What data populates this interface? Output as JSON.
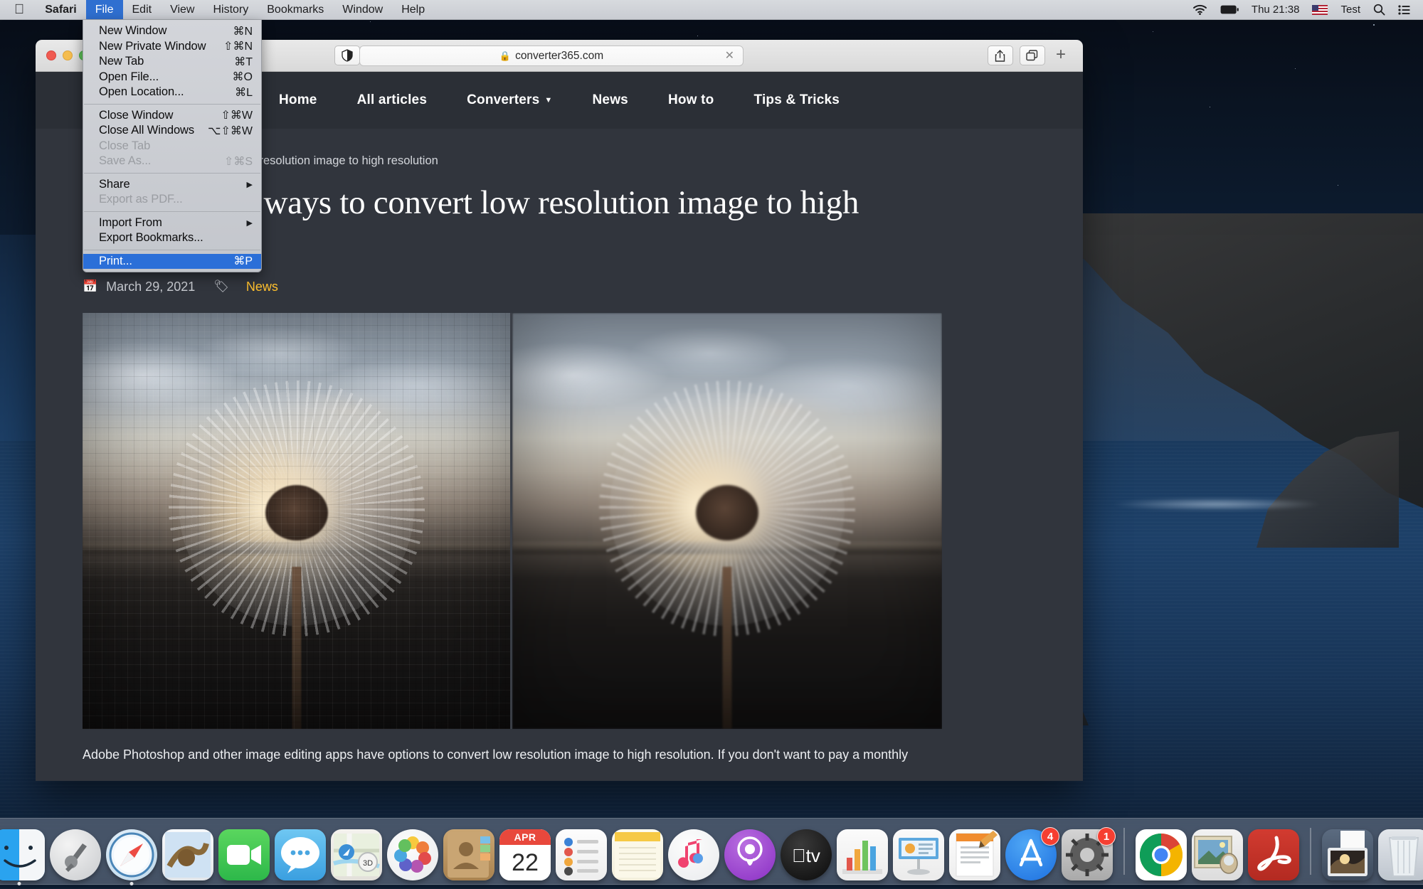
{
  "menubar": {
    "apple_logo": "apple-logo",
    "items": [
      {
        "label": "Safari",
        "active": false,
        "bold": true
      },
      {
        "label": "File",
        "active": true,
        "bold": false
      },
      {
        "label": "Edit",
        "active": false,
        "bold": false
      },
      {
        "label": "View",
        "active": false,
        "bold": false
      },
      {
        "label": "History",
        "active": false,
        "bold": false
      },
      {
        "label": "Bookmarks",
        "active": false,
        "bold": false
      },
      {
        "label": "Window",
        "active": false,
        "bold": false
      },
      {
        "label": "Help",
        "active": false,
        "bold": false
      }
    ],
    "status": {
      "wifi_icon": "wifi-icon",
      "battery_icon": "battery-icon",
      "clock": "Thu 21:38",
      "flag_icon": "us-flag-icon",
      "user": "Test",
      "search_icon": "spotlight-search-icon",
      "control_center_icon": "control-center-icon"
    }
  },
  "file_menu": {
    "groups": [
      [
        {
          "label": "New Window",
          "shortcut": "⌘N",
          "disabled": false,
          "submenu": false
        },
        {
          "label": "New Private Window",
          "shortcut": "⇧⌘N",
          "disabled": false,
          "submenu": false
        },
        {
          "label": "New Tab",
          "shortcut": "⌘T",
          "disabled": false,
          "submenu": false
        },
        {
          "label": "Open File...",
          "shortcut": "⌘O",
          "disabled": false,
          "submenu": false
        },
        {
          "label": "Open Location...",
          "shortcut": "⌘L",
          "disabled": false,
          "submenu": false
        }
      ],
      [
        {
          "label": "Close Window",
          "shortcut": "⇧⌘W",
          "disabled": false,
          "submenu": false
        },
        {
          "label": "Close All Windows",
          "shortcut": "⌥⇧⌘W",
          "disabled": false,
          "submenu": false
        },
        {
          "label": "Close Tab",
          "shortcut": "",
          "disabled": true,
          "submenu": false
        },
        {
          "label": "Save As...",
          "shortcut": "⇧⌘S",
          "disabled": true,
          "submenu": false
        }
      ],
      [
        {
          "label": "Share",
          "shortcut": "",
          "disabled": false,
          "submenu": true
        },
        {
          "label": "Export as PDF...",
          "shortcut": "",
          "disabled": true,
          "submenu": false
        }
      ],
      [
        {
          "label": "Import From",
          "shortcut": "",
          "disabled": false,
          "submenu": true
        },
        {
          "label": "Export Bookmarks...",
          "shortcut": "",
          "disabled": false,
          "submenu": false
        }
      ],
      [
        {
          "label": "Print...",
          "shortcut": "⌘P",
          "disabled": false,
          "submenu": false,
          "selected": true
        }
      ]
    ],
    "highlight_color": "#2b6fd8"
  },
  "browser": {
    "traffic_lights": [
      "close",
      "minimize",
      "zoom"
    ],
    "privacy_icon": "shield-privacy-icon",
    "reader_icon": "reader-view-icon",
    "url": "converter365.com",
    "lock_icon": "lock-icon",
    "stop_icon": "stop-reload-icon",
    "share_icon": "share-icon",
    "tabs_icon": "tab-overview-icon",
    "new_tab_icon": "new-tab-plus-icon"
  },
  "site": {
    "nav": [
      {
        "label": "Home",
        "caret": false
      },
      {
        "label": "All articles",
        "caret": false
      },
      {
        "label": "Converters",
        "caret": true
      },
      {
        "label": "News",
        "caret": false
      },
      {
        "label": "How to",
        "caret": false
      },
      {
        "label": "Tips & Tricks",
        "caret": false
      }
    ],
    "breadcrumb": "Three simple ways to convert low resolution image to high resolution",
    "title": "Three simple ways to convert low resolution image to high resolution",
    "date": "March 29, 2021",
    "date_icon": "calendar-icon",
    "tag": "News",
    "tag_icon": "tag-icon",
    "tag_color": "#ffc02e",
    "comparison": {
      "left_alt": "low resolution pixelated dandelion at sunset",
      "right_alt": "high resolution smooth dandelion at sunset"
    },
    "body": "Adobe Photoshop and other image editing apps have options to convert low resolution image to high resolution. If you don't want to pay a monthly"
  },
  "dock": {
    "items": [
      {
        "name": "finder",
        "label": "Finder",
        "running": true,
        "badge": ""
      },
      {
        "name": "launchpad",
        "label": "Launchpad",
        "running": false,
        "badge": ""
      },
      {
        "name": "safari",
        "label": "Safari",
        "running": true,
        "badge": ""
      },
      {
        "name": "mail",
        "label": "Mail",
        "running": false,
        "badge": ""
      },
      {
        "name": "facetime",
        "label": "FaceTime",
        "running": false,
        "badge": ""
      },
      {
        "name": "messages",
        "label": "Messages",
        "running": false,
        "badge": ""
      },
      {
        "name": "maps",
        "label": "Maps",
        "running": false,
        "badge": ""
      },
      {
        "name": "photos",
        "label": "Photos",
        "running": false,
        "badge": ""
      },
      {
        "name": "contacts",
        "label": "Contacts",
        "running": false,
        "badge": ""
      },
      {
        "name": "calendar",
        "label": "Calendar",
        "running": false,
        "badge": "",
        "month": "APR",
        "day": "22"
      },
      {
        "name": "reminders",
        "label": "Reminders",
        "running": false,
        "badge": ""
      },
      {
        "name": "notes",
        "label": "Notes",
        "running": false,
        "badge": ""
      },
      {
        "name": "music",
        "label": "Music",
        "running": false,
        "badge": ""
      },
      {
        "name": "podcasts",
        "label": "Podcasts",
        "running": false,
        "badge": ""
      },
      {
        "name": "tv",
        "label": "TV",
        "running": false,
        "badge": ""
      },
      {
        "name": "numbers",
        "label": "Numbers",
        "running": false,
        "badge": ""
      },
      {
        "name": "keynote",
        "label": "Keynote",
        "running": false,
        "badge": ""
      },
      {
        "name": "pages",
        "label": "Pages",
        "running": false,
        "badge": ""
      },
      {
        "name": "app-store",
        "label": "App Store",
        "running": false,
        "badge": "4"
      },
      {
        "name": "system-preferences",
        "label": "System Preferences",
        "running": false,
        "badge": "1"
      },
      {
        "name": "chrome",
        "label": "Google Chrome",
        "running": false,
        "badge": ""
      },
      {
        "name": "preview",
        "label": "Preview",
        "running": false,
        "badge": ""
      },
      {
        "name": "acrobat",
        "label": "Adobe Acrobat Reader",
        "running": false,
        "badge": ""
      },
      {
        "name": "downloads",
        "label": "Downloads",
        "running": false,
        "badge": ""
      },
      {
        "name": "trash",
        "label": "Trash",
        "running": false,
        "badge": ""
      }
    ]
  }
}
